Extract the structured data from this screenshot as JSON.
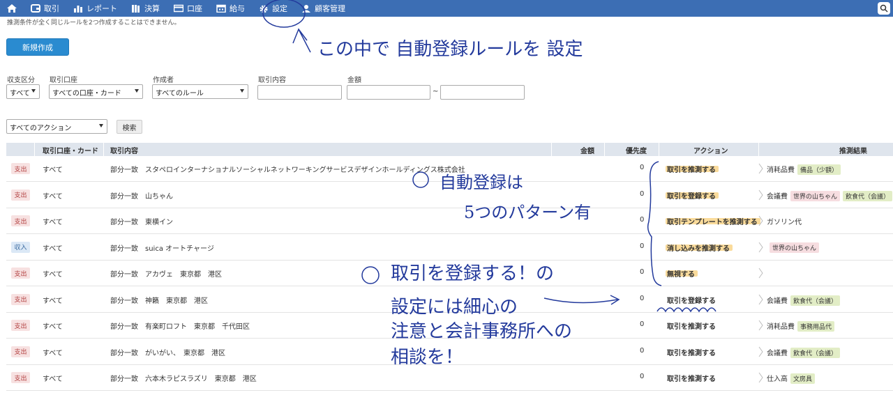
{
  "nav": {
    "items": [
      {
        "label": "取引",
        "icon": "wallet-icon"
      },
      {
        "label": "レポート",
        "icon": "bar-chart-icon"
      },
      {
        "label": "決算",
        "icon": "books-icon"
      },
      {
        "label": "口座",
        "icon": "card-icon"
      },
      {
        "label": "給与",
        "icon": "calendar-icon"
      },
      {
        "label": "設定",
        "icon": "gear-icon"
      },
      {
        "label": "顧客管理",
        "icon": "person-icon"
      }
    ]
  },
  "notice": "推測条件が全く同じルールを2つ作成することはできません。",
  "new_button": "新規作成",
  "filters": {
    "direction": {
      "label": "収支区分",
      "value": "すべて"
    },
    "account": {
      "label": "取引口座",
      "value": "すべての口座・カード"
    },
    "creator": {
      "label": "作成者",
      "value": "すべてのルール"
    },
    "content": {
      "label": "取引内容",
      "value": ""
    },
    "amount": {
      "label": "金額",
      "from": "",
      "tilde": "~",
      "to": ""
    },
    "action": {
      "value": "すべてのアクション"
    },
    "search_button": "検索"
  },
  "table": {
    "headers": {
      "account": "取引口座・カード",
      "content": "取引内容",
      "amount": "金額",
      "priority": "優先度",
      "action": "アクション",
      "result": "推測結果"
    },
    "rows": [
      {
        "type": "支出",
        "kind": "out",
        "account": "すべて",
        "match": "部分一致",
        "content": "スタペロインターナショナルソーシャルネットワーキングサービスデザインホールディングス株式会社",
        "priority": "0",
        "action": "取引を推測する",
        "highlight": true,
        "result": "消耗品費",
        "tags": [
          {
            "t": "備品（少額）",
            "c": "green"
          }
        ]
      },
      {
        "type": "支出",
        "kind": "out",
        "account": "すべて",
        "match": "部分一致",
        "content": "山ちゃん",
        "priority": "0",
        "action": "取引を登録する",
        "highlight": true,
        "result": "会議費",
        "tags": [
          {
            "t": "世界の山ちゃん",
            "c": "pink"
          },
          {
            "t": "飲食代（会議）",
            "c": "green"
          }
        ]
      },
      {
        "type": "支出",
        "kind": "out",
        "account": "すべて",
        "match": "部分一致",
        "content": "東横イン",
        "priority": "0",
        "action": "取引テンプレートを推測する",
        "highlight": true,
        "result": "ガソリン代",
        "tags": []
      },
      {
        "type": "収入",
        "kind": "in",
        "account": "すべて",
        "match": "部分一致",
        "content": "suica オートチャージ",
        "priority": "0",
        "action": "消し込みを推測する",
        "highlight": true,
        "result": "",
        "tags": [
          {
            "t": "世界の山ちゃん",
            "c": "pink"
          }
        ]
      },
      {
        "type": "支出",
        "kind": "out",
        "account": "すべて",
        "match": "部分一致",
        "content": "アカヴェ　東京都　港区",
        "priority": "0",
        "action": "無視する",
        "highlight": true,
        "result": "",
        "tags": []
      },
      {
        "type": "支出",
        "kind": "out",
        "account": "すべて",
        "match": "部分一致",
        "content": "神籟　東京都　港区",
        "priority": "0",
        "action": "取引を登録する",
        "highlight": false,
        "result": "会議費",
        "tags": [
          {
            "t": "飲食代（会議）",
            "c": "green"
          }
        ]
      },
      {
        "type": "支出",
        "kind": "out",
        "account": "すべて",
        "match": "部分一致",
        "content": "有楽町ロフト　東京都　千代田区",
        "priority": "0",
        "action": "取引を推測する",
        "highlight": false,
        "result": "消耗品費",
        "tags": [
          {
            "t": "事務用品代",
            "c": "green"
          }
        ]
      },
      {
        "type": "支出",
        "kind": "out",
        "account": "すべて",
        "match": "部分一致",
        "content": "がいがい、　東京都　港区",
        "priority": "0",
        "action": "取引を推測する",
        "highlight": false,
        "result": "会議費",
        "tags": [
          {
            "t": "飲食代（会議）",
            "c": "green"
          }
        ]
      },
      {
        "type": "支出",
        "kind": "out",
        "account": "すべて",
        "match": "部分一致",
        "content": "六本木ラピスラズリ　東京都　港区",
        "priority": "0",
        "action": "取引を推測する",
        "highlight": false,
        "result": "仕入高",
        "tags": [
          {
            "t": "文房具",
            "c": "green"
          }
        ]
      }
    ]
  },
  "annotations": {
    "top": "この中で 自動登録ルールを 設定",
    "mid1": "自動登録は",
    "mid2": "5つのパターン有",
    "lower1": "取引を登録する！の",
    "lower2": "設定には細心の",
    "lower3": "注意と会計事務所への",
    "lower4": "相談を！"
  }
}
